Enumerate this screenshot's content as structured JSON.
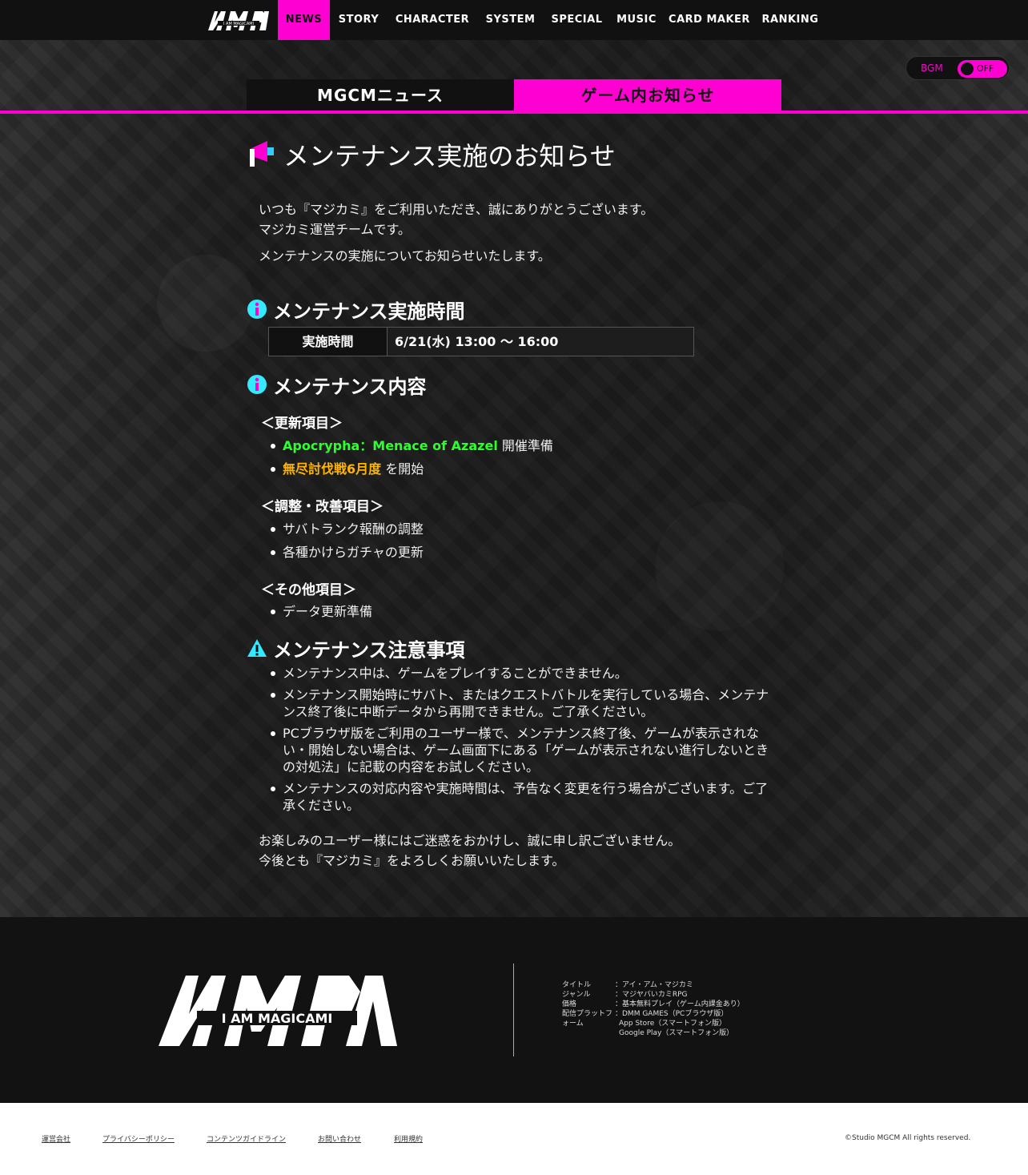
{
  "header": {
    "logo_alt": "I AM MAGICAMI",
    "nav": [
      {
        "label": "NEWS",
        "active": true
      },
      {
        "label": "STORY"
      },
      {
        "label": "CHARACTER"
      },
      {
        "label": "SYSTEM"
      },
      {
        "label": "SPECIAL"
      },
      {
        "label": "MUSIC"
      },
      {
        "label": "CARD MAKER"
      },
      {
        "label": "RANKING"
      }
    ],
    "accent_color": "#ff00d2"
  },
  "bgm": {
    "label": "BGM",
    "state": "OFF"
  },
  "tabs": [
    {
      "label": "MGCMニュース"
    },
    {
      "label": "ゲーム内お知らせ",
      "active": true
    }
  ],
  "article": {
    "title": "メンテナンス実施のお知らせ",
    "intro_1": "いつも『マジカミ』をご利用いただき、誠にありがとうございます。",
    "intro_2": "マジカミ運営チームです。",
    "intro_3": "メンテナンスの実施についてお知らせいたします。",
    "time_section": {
      "title": "メンテナンス実施時間",
      "label": "実施時間",
      "value": "6/21(水) 13:00 ～ 16:00"
    },
    "content_section": {
      "title": "メンテナンス内容",
      "update_heading": "＜更新項目＞",
      "update_items": [
        {
          "highlight": "Apocrypha：Menace of Azazel",
          "rest": " 開催準備"
        },
        {
          "highlight": "無尽討伐戦6月度",
          "rest": " を開始"
        }
      ],
      "adjust_heading": "＜調整・改善項目＞",
      "adjust_items": [
        "サバトランク報酬の調整",
        "各種かけらガチャの更新"
      ],
      "other_heading": "＜その他項目＞",
      "other_items": [
        "データ更新準備"
      ]
    },
    "notes_section": {
      "title": "メンテナンス注意事項",
      "items": [
        "メンテナンス中は、ゲームをプレイすることができません。",
        "メンテナンス開始時にサバト、またはクエストバトルを実行している場合、メンテナンス終了後に中断データから再開できません。ご了承ください。",
        "PCブラウザ版をご利用のユーザー様で、メンテナンス終了後、ゲームが表示されない・開始しない場合は、ゲーム画面下にある「ゲームが表示されない進行しないときの対処法」に記載の内容をお試しください。",
        "メンテナンスの対応内容や実施時間は、予告なく変更を行う場合がございます。ご了承ください。"
      ]
    },
    "closing_1": "お楽しみのユーザー様にはご迷惑をおかけし、誠に申し訳ございません。",
    "closing_2": "今後とも『マジカミ』をよろしくお願いいたします。"
  },
  "footer": {
    "logo_alt": "I AM MAGICAMI",
    "info": [
      {
        "k": "タイトル",
        "v": "：アイ・アム・マジカミ"
      },
      {
        "k": "ジャンル",
        "v": "：マジヤバいカミRPG"
      },
      {
        "k": "価格",
        "v": "：基本無料プレイ（ゲーム内課金あり）"
      },
      {
        "k": "配信プラットフォーム",
        "v": "：DMM GAMES（PCブラウザ版）"
      },
      {
        "k": "",
        "v": "App Store（スマートフォン版）"
      },
      {
        "k": "",
        "v": "Google Play（スマートフォン版）"
      }
    ],
    "links": [
      "運営会社",
      "プライバシーポリシー",
      "コンテンツガイドライン",
      "お問い合わせ",
      "利用規約"
    ],
    "copyright": "©Studio MGCM All rights reserved."
  }
}
